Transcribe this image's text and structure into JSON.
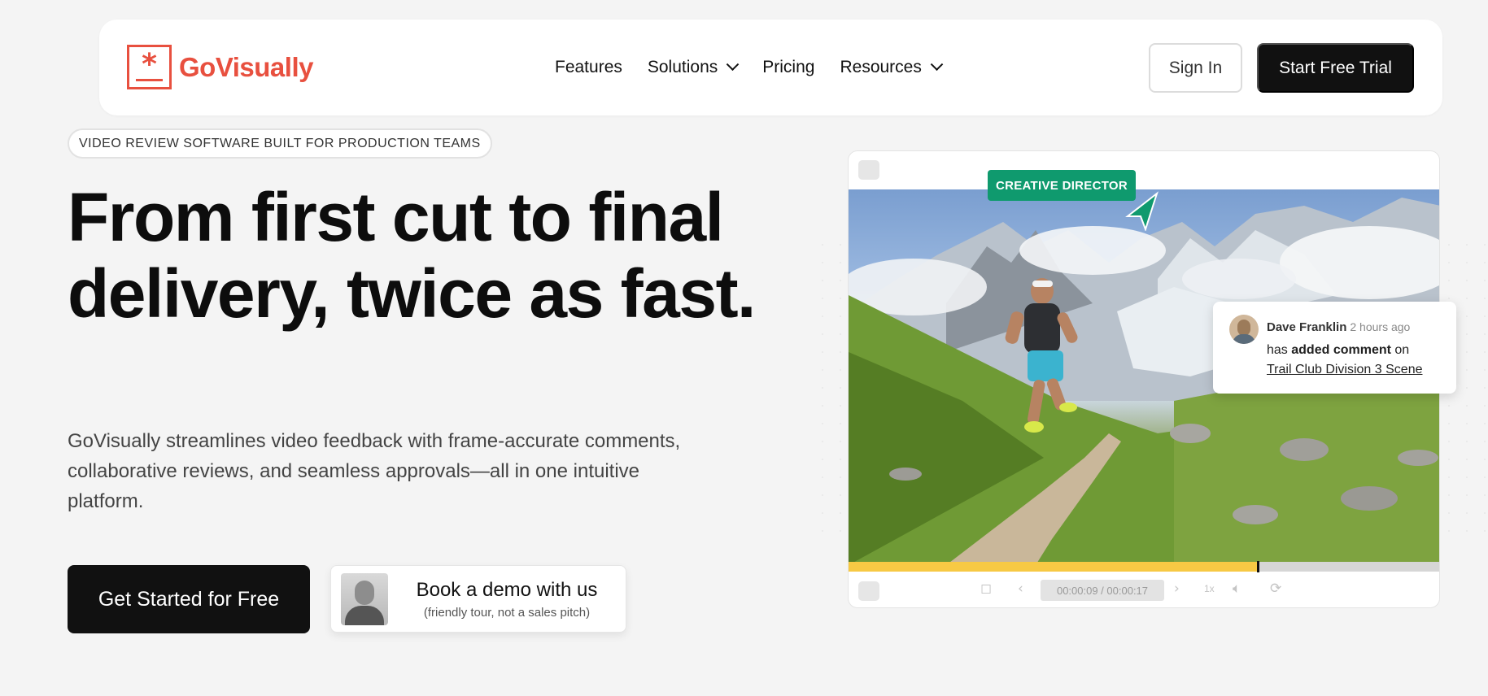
{
  "nav": {
    "logo_text": "GoVisually",
    "menu": [
      {
        "label": "Features",
        "has_dropdown": false
      },
      {
        "label": "Solutions",
        "has_dropdown": true
      },
      {
        "label": "Pricing",
        "has_dropdown": false
      },
      {
        "label": "Resources",
        "has_dropdown": true
      }
    ],
    "sign_in": "Sign In",
    "start_trial": "Start Free Trial"
  },
  "hero": {
    "tagline": "VIDEO REVIEW SOFTWARE BUILT FOR PRODUCTION TEAMS",
    "headline": "From first cut to final delivery, twice as fast.",
    "subtext": "GoVisually streamlines video feedback with frame-accurate comments, collaborative reviews, and seamless approvals—all in one intuitive platform.",
    "cta_primary": "Get Started for Free",
    "demo_title": "Book a demo with us",
    "demo_subtitle": "(friendly tour, not a sales pitch)"
  },
  "player": {
    "label_tag": "CREATIVE DIRECTOR",
    "timecode": "00:00:09 / 00:00:17",
    "progress": 0.69,
    "speed": "1x",
    "comment": {
      "author": "Dave Franklin",
      "time": "2 hours ago",
      "prefix": "has",
      "action": "added comment",
      "suffix": "on",
      "target": "Trail Club Division 3 Scene"
    }
  },
  "colors": {
    "brand": "#e8503f",
    "accent_green": "#0f9a6e",
    "progress": "#f7c944"
  }
}
